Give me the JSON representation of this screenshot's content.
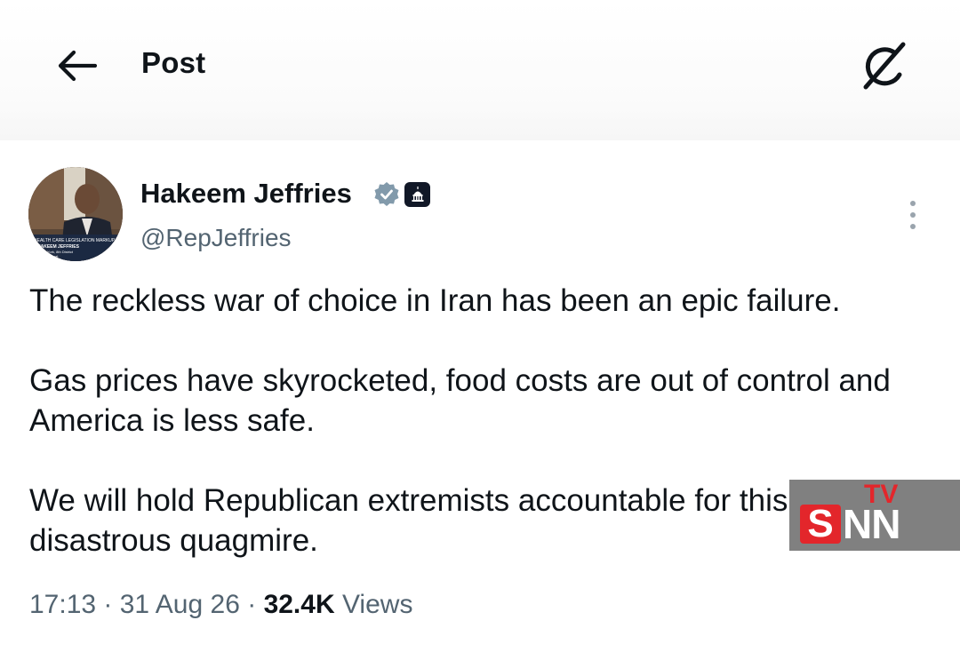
{
  "header": {
    "title": "Post",
    "back_icon": "arrow-left-icon",
    "grok_icon": "grok-slash-circle-icon"
  },
  "author": {
    "name": "Hakeem Jeffries",
    "handle": "@RepJeffries",
    "verified_icon": "verified-badge-icon",
    "affiliation_icon": "capitol-building-icon",
    "avatar_caption_lines": [
      "HEALTH CARE LEGISLATION MARKUP",
      "HAKEEM JEFFRIES",
      "New York, 8th District",
      "Democrat"
    ]
  },
  "tweet": {
    "paragraphs": [
      "The reckless war of choice in Iran has been an epic failure.",
      "Gas prices have skyrocketed, food costs are out of control and America is less safe.",
      "We will hold Republican extremists accountable for this disastrous quagmire."
    ]
  },
  "meta": {
    "time": "17:13",
    "date": "31 Aug 26",
    "separator": " · ",
    "views_count": "32.4K",
    "views_label": " Views"
  },
  "watermark": {
    "brand_s": "S",
    "brand_nn": "NN",
    "brand_tv": "TV"
  },
  "colors": {
    "text_primary": "#0f1419",
    "text_secondary": "#536471",
    "verified_badge": "#829aab",
    "watermark_red": "#e3262b"
  }
}
